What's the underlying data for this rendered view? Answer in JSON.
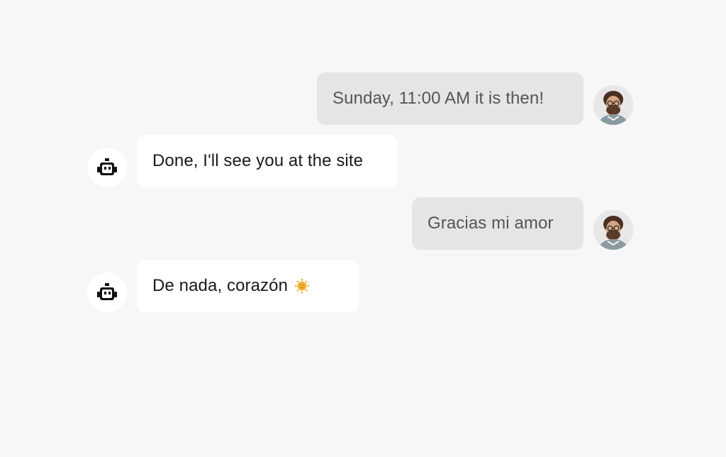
{
  "messages": [
    {
      "role": "user",
      "text": "Sunday, 11:00 AM it is then!"
    },
    {
      "role": "bot",
      "text": "Done, I'll see you at the site"
    },
    {
      "role": "user",
      "text": "Gracias mi amor"
    },
    {
      "role": "bot",
      "text": "De nada, corazón",
      "emoji": "sun-emoji"
    }
  ],
  "colors": {
    "background": "#f7f7f7",
    "user_bubble": "#e5e5e5",
    "bot_bubble": "#ffffff",
    "user_text": "#555555",
    "bot_text": "#1a1a1a",
    "emoji_sun": "#f2b134"
  },
  "avatars": {
    "user": "user-photo-avatar",
    "bot": "robot-icon"
  }
}
